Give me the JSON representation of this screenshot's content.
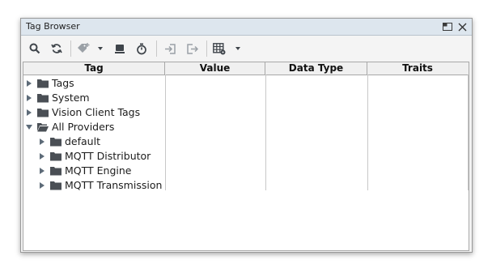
{
  "window": {
    "title": "Tag Browser"
  },
  "toolbar": {
    "buttons": [
      {
        "name": "search-icon"
      },
      {
        "name": "refresh-icon"
      },
      {
        "name": "add-tag-icon"
      },
      {
        "name": "dropdown-arrow-icon"
      },
      {
        "name": "server-icon"
      },
      {
        "name": "timer-icon"
      },
      {
        "name": "import-icon"
      },
      {
        "name": "export-icon"
      },
      {
        "name": "table-columns-icon"
      },
      {
        "name": "dropdown-arrow-icon"
      }
    ]
  },
  "table": {
    "columns": [
      "Tag",
      "Value",
      "Data Type",
      "Traits"
    ],
    "rows": [
      {
        "label": "Tags",
        "level": 0,
        "expanded": false
      },
      {
        "label": "System",
        "level": 0,
        "expanded": false
      },
      {
        "label": "Vision Client Tags",
        "level": 0,
        "expanded": false
      },
      {
        "label": "All Providers",
        "level": 0,
        "expanded": true
      },
      {
        "label": "default",
        "level": 1,
        "expanded": false
      },
      {
        "label": "MQTT Distributor",
        "level": 1,
        "expanded": false
      },
      {
        "label": "MQTT Engine",
        "level": 1,
        "expanded": false
      },
      {
        "label": "MQTT Transmission",
        "level": 1,
        "expanded": false
      }
    ]
  },
  "colors": {
    "titlebar": "#dde6ee",
    "folder": "#4a4f55",
    "icon": "#3f454b",
    "disabled_icon": "#9aa0a6"
  }
}
